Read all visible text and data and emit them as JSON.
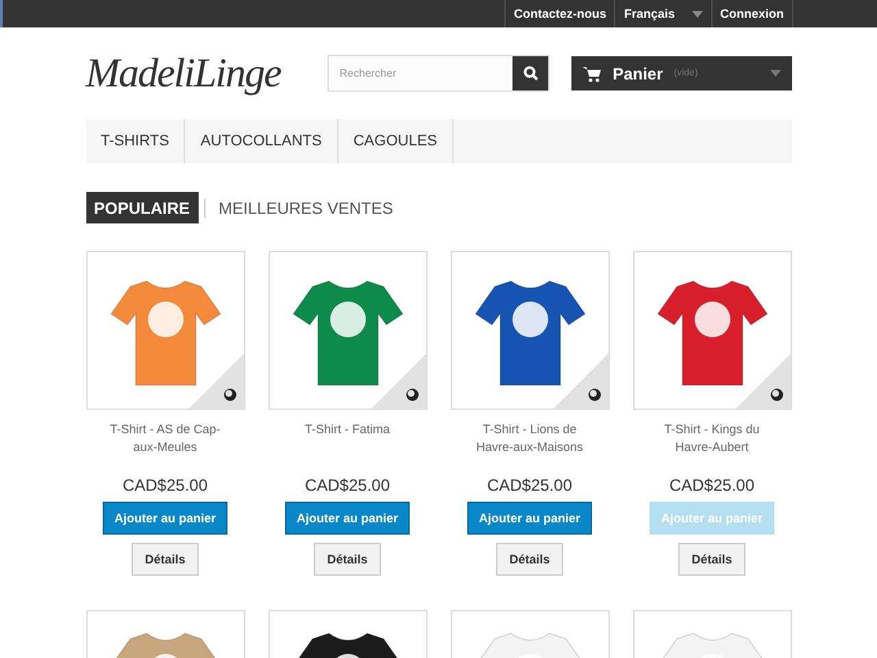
{
  "top_bar": {
    "links": [
      {
        "label": "Contactez-nous",
        "kind": "link"
      },
      {
        "label": "Français",
        "kind": "dropdown"
      },
      {
        "label": "Connexion",
        "kind": "link"
      }
    ]
  },
  "header": {
    "logo": "MadeliLinge",
    "search": {
      "placeholder": "Rechercher"
    },
    "cart": {
      "label": "Panier",
      "status": "(vide)"
    }
  },
  "menu": [
    {
      "label": "T-SHIRTS"
    },
    {
      "label": "AUTOCOLLANTS"
    },
    {
      "label": "CAGOULES"
    }
  ],
  "tabs": [
    {
      "label": "POPULAIRE",
      "selected": true
    },
    {
      "label": "MEILLEURES VENTES",
      "selected": false
    }
  ],
  "products": [
    {
      "name": "T-Shirt - AS de Cap-aux-Meules",
      "color": "#f48a3c",
      "price": "CAD$25.00",
      "add": "Ajouter au panier",
      "disabled": false,
      "details": "Détails"
    },
    {
      "name": "T-Shirt - Fatima",
      "color": "#0e8a4a",
      "price": "CAD$25.00",
      "add": "Ajouter au panier",
      "disabled": false,
      "details": "Détails"
    },
    {
      "name": "T-Shirt - Lions de Havre-aux-Maisons",
      "color": "#1554b0",
      "price": "CAD$25.00",
      "add": "Ajouter au panier",
      "disabled": false,
      "details": "Détails"
    },
    {
      "name": "T-Shirt - Kings du Havre-Aubert",
      "color": "#d8202c",
      "price": "CAD$25.00",
      "add": "Ajouter au panier",
      "disabled": true,
      "details": "Détails"
    }
  ],
  "more_products": [
    {
      "color": "#c8a77e"
    },
    {
      "color": "#1c1c1c"
    },
    {
      "color": "#f4f4f4"
    },
    {
      "color": "#f4f4f4"
    }
  ]
}
